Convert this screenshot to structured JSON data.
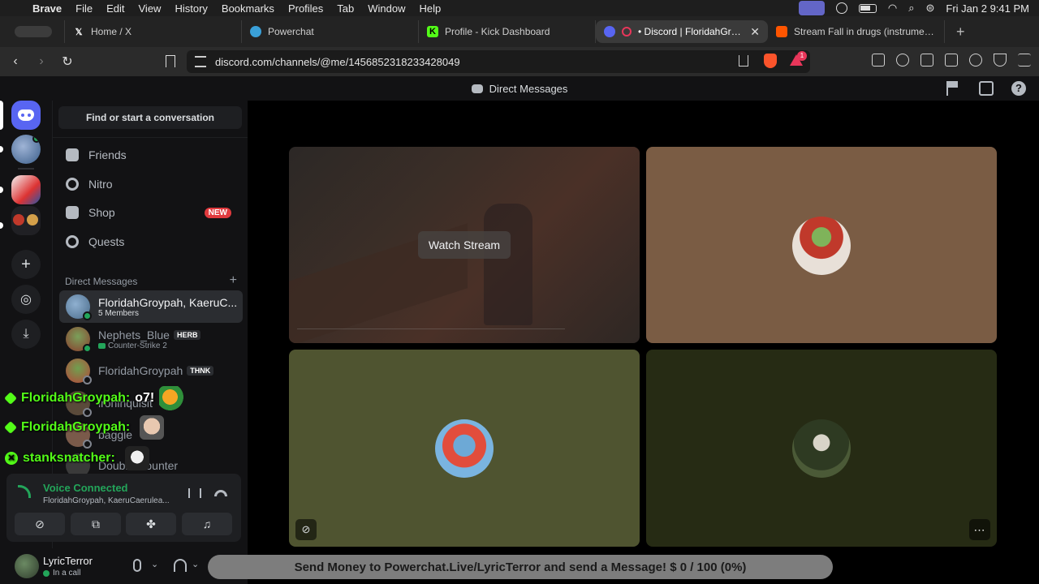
{
  "menubar": {
    "app": "Brave",
    "items": [
      "File",
      "Edit",
      "View",
      "History",
      "Bookmarks",
      "Profiles",
      "Tab",
      "Window",
      "Help"
    ],
    "datetime": "Fri Jan 2  9:41 PM"
  },
  "tabs": [
    {
      "title": "Home / X",
      "icon": "x-icon"
    },
    {
      "title": "Powerchat",
      "icon": "powerchat-icon"
    },
    {
      "title": "Profile - Kick Dashboard",
      "icon": "kick-icon"
    },
    {
      "title": "• Discord | FloridahGroypah",
      "icon": "discord-icon",
      "active": true
    },
    {
      "title": "Stream Fall in drugs (instrumental)",
      "icon": "soundcloud-icon"
    }
  ],
  "address": {
    "url": "discord.com/channels/@me/1456852318233428049",
    "rewards_count": "1"
  },
  "discord": {
    "title": "Direct Messages",
    "search_label": "Find or start a conversation",
    "nav": [
      {
        "label": "Friends",
        "icon": "friends-icon"
      },
      {
        "label": "Nitro",
        "icon": "nitro-icon"
      },
      {
        "label": "Shop",
        "icon": "shop-icon",
        "badge": "NEW"
      },
      {
        "label": "Quests",
        "icon": "quests-icon"
      }
    ],
    "dm_header": "Direct Messages",
    "dms": [
      {
        "name": "FloridahGroypah, KaeruC...",
        "sub": "5 Members"
      },
      {
        "name": "Nephets_Blue",
        "tag": "HERB",
        "sub": "Counter-Strike 2"
      },
      {
        "name": "FloridahGroypah",
        "tag": "THNK",
        "sub": ""
      },
      {
        "name": "ironinquisit",
        "sub": ""
      },
      {
        "name": "baggle",
        "sub": ""
      },
      {
        "name": "Double Counter",
        "sub": ""
      }
    ],
    "voice": {
      "status": "Voice Connected",
      "channel": "FloridahGroypah, KaeruCaerulea..."
    },
    "user": {
      "name": "LyricTerror",
      "status": "In a call"
    },
    "stage": {
      "watch_label": "Watch Stream"
    }
  },
  "chat_overlay": [
    {
      "user": "FloridahGroypah:",
      "message": "o7!",
      "badge": "heart-badge"
    },
    {
      "user": "FloridahGroypah:",
      "message": "",
      "badge": "heart-badge"
    },
    {
      "user": "stanksnatcher:",
      "message": "",
      "badge": "kick-badge"
    }
  ],
  "donation_bar": "Send Money to Powerchat.Live/LyricTerror and send a Message! $ 0 / 100 (0%)",
  "colors": {
    "discord_blurple": "#5865f2",
    "voice_green": "#23a55a",
    "kick_green": "#53fc18",
    "new_badge": "#e03a3e"
  }
}
